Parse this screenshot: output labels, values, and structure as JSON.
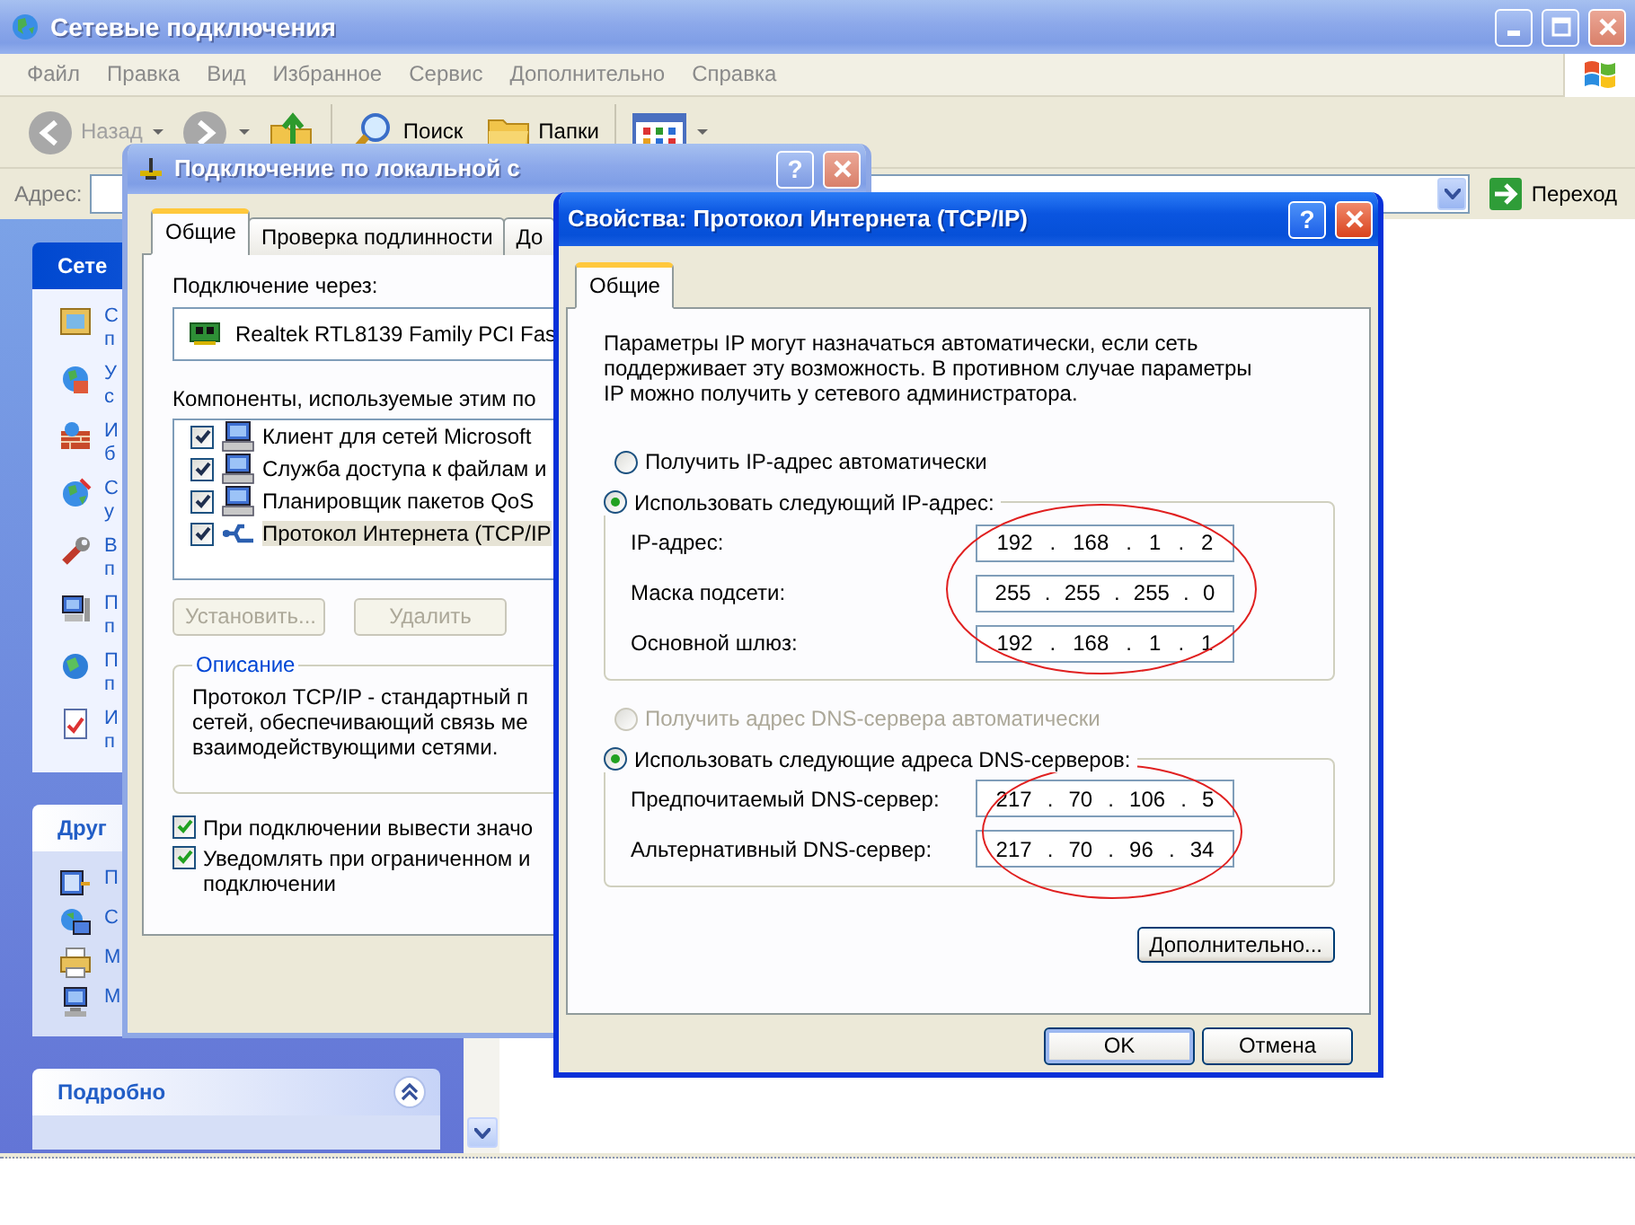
{
  "explorer": {
    "title": "Сетевые подключения",
    "active": false,
    "menu": [
      "Файл",
      "Правка",
      "Вид",
      "Избранное",
      "Сервис",
      "Дополнительно",
      "Справка"
    ],
    "toolbar": [
      {
        "kind": "back",
        "label": "Назад",
        "disabled": true
      },
      {
        "kind": "forward",
        "disabled": true
      },
      {
        "kind": "up"
      },
      {
        "kind": "search",
        "label": "Поиск",
        "disabled": false
      },
      {
        "kind": "folders",
        "label": "Папки",
        "disabled": false
      },
      {
        "kind": "views"
      }
    ],
    "address_label": "Адрес:",
    "go_button": "Переход",
    "task_panes": [
      {
        "kind": "special",
        "title": "Сете",
        "items": [
          {
            "lines": [
              "С",
              "п"
            ]
          },
          {
            "lines": [
              "У",
              "с"
            ]
          },
          {
            "lines": [
              "И",
              "б"
            ]
          },
          {
            "lines": [
              "С",
              "у"
            ]
          },
          {
            "lines": [
              "В",
              "п"
            ]
          },
          {
            "lines": [
              "П",
              "п"
            ]
          },
          {
            "lines": [
              "П",
              "п"
            ]
          },
          {
            "lines": [
              "И",
              "п"
            ]
          }
        ]
      },
      {
        "kind": "normal",
        "title": "Друг",
        "items": [
          {
            "lines": [
              "П"
            ]
          },
          {
            "lines": [
              "С"
            ]
          },
          {
            "lines": [
              "М"
            ]
          },
          {
            "lines": [
              "М"
            ]
          }
        ]
      },
      {
        "kind": "normal",
        "title": "Подробно"
      }
    ]
  },
  "connection_dialog": {
    "title": "Подключение по локальной с",
    "active": false,
    "help_button": "?",
    "tabs": [
      {
        "label": "Общие",
        "selected": true
      },
      {
        "label": "Проверка подлинности",
        "selected": false
      },
      {
        "label": "До",
        "selected": false
      }
    ],
    "connect_using_label": "Подключение через:",
    "adapter": "Realtek RTL8139 Family PCI Fas",
    "components_label": "Компоненты, используемые этим по",
    "components": [
      {
        "kind": "computer",
        "label": "Клиент для сетей Microsoft",
        "checked": true,
        "selected": false
      },
      {
        "kind": "computer",
        "label": "Служба доступа к файлам и",
        "checked": true,
        "selected": false
      },
      {
        "kind": "computer",
        "label": "Планировщик пакетов QoS",
        "checked": true,
        "selected": false
      },
      {
        "kind": "protocol",
        "label": "Протокол Интернета (TCP/IP",
        "checked": true,
        "selected": true
      }
    ],
    "buttons": [
      {
        "label": "Установить...",
        "disabled": true
      },
      {
        "label": "Удалить",
        "disabled": true
      }
    ],
    "description_title": "Описание",
    "description_lines": [
      "Протокол TCP/IP - стандартный п",
      "сетей, обеспечивающий связь ме",
      "взаимодействующими сетями."
    ],
    "options": [
      {
        "lines": [
          "При подключении вывести значо"
        ],
        "checked": true
      },
      {
        "lines": [
          "Уведомлять при ограниченном и",
          "подключении"
        ],
        "checked": true
      }
    ]
  },
  "tcpip_dialog": {
    "title": "Свойства: Протокол Интернета (TCP/IP)",
    "active": true,
    "help_button": "?",
    "tabs": [
      {
        "label": "Общие",
        "selected": true
      }
    ],
    "intro_lines": [
      "Параметры IP могут назначаться автоматически, если сеть",
      "поддерживает эту возможность. В противном случае параметры",
      "IP можно получить у сетевого администратора."
    ],
    "octet_separator": ".",
    "ip_mode": [
      {
        "label": "Получить IP-адрес автоматически",
        "selected": false,
        "disabled": false
      },
      {
        "label": "Использовать следующий IP-адрес:",
        "selected": true,
        "disabled": false
      }
    ],
    "ip_fields": [
      {
        "label": "IP-адрес:",
        "octets": [
          "192",
          "168",
          "1",
          "2"
        ]
      },
      {
        "label": "Маска подсети:",
        "octets": [
          "255",
          "255",
          "255",
          "0"
        ]
      },
      {
        "label": "Основной шлюз:",
        "octets": [
          "192",
          "168",
          "1",
          "1"
        ]
      }
    ],
    "ip_circled": true,
    "dns_mode": [
      {
        "label": "Получить адрес DNS-сервера автоматически",
        "selected": false,
        "disabled": true
      },
      {
        "label": "Использовать следующие адреса DNS-серверов:",
        "selected": true,
        "disabled": false
      }
    ],
    "dns_fields": [
      {
        "label": "Предпочитаемый DNS-сервер:",
        "octets": [
          "217",
          "70",
          "106",
          "5"
        ]
      },
      {
        "label": "Альтернативный DNS-сервер:",
        "octets": [
          "217",
          "70",
          "96",
          "34"
        ]
      }
    ],
    "dns_circled": true,
    "advanced_button": "Дополнительно...",
    "buttons": [
      {
        "label": "OK",
        "default": true
      },
      {
        "label": "Отмена",
        "default": false
      }
    ]
  }
}
